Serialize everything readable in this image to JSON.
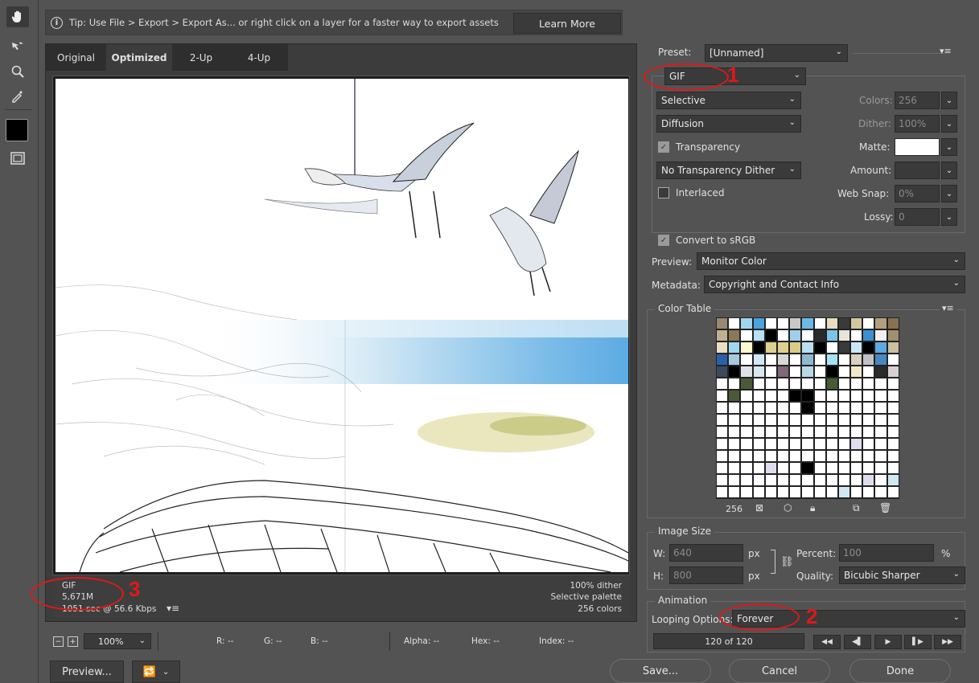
{
  "tip": {
    "text": "Tip: Use File > Export > Export As...  or right click on a layer for a faster way to export assets",
    "learn_more": "Learn More"
  },
  "tabs": [
    "Original",
    "Optimized",
    "2-Up",
    "4-Up"
  ],
  "image_info": {
    "format": "GIF",
    "size": "5,671M",
    "time": "1051 sec @ 56.6 Kbps",
    "dither": "100% dither",
    "palette": "Selective palette",
    "colors": "256 colors"
  },
  "status": {
    "zoom": "100%",
    "r": "R: --",
    "g": "G: --",
    "b": "B: --",
    "alpha": "Alpha: --",
    "hex": "Hex: --",
    "index": "Index: --"
  },
  "buttons": {
    "preview": "Preview...",
    "save": "Save...",
    "cancel": "Cancel",
    "done": "Done"
  },
  "settings": {
    "preset_label": "Preset:",
    "preset_value": "[Unnamed]",
    "format": "GIF",
    "reduction": "Selective",
    "dither_algo": "Diffusion",
    "colors_label": "Colors:",
    "colors_value": "256",
    "dither_label": "Dither:",
    "dither_value": "100%",
    "transparency_label": "Transparency",
    "matte_label": "Matte:",
    "transparency_dither": "No Transparency Dither",
    "amount_label": "Amount:",
    "interlaced_label": "Interlaced",
    "websnap_label": "Web Snap:",
    "websnap_value": "0%",
    "lossy_label": "Lossy:",
    "lossy_value": "0",
    "convert_srgb": "Convert to sRGB",
    "preview_label": "Preview:",
    "preview_value": "Monitor Color",
    "metadata_label": "Metadata:",
    "metadata_value": "Copyright and Contact Info"
  },
  "color_table": {
    "title": "Color Table",
    "count": "256"
  },
  "image_size": {
    "title": "Image Size",
    "w_label": "W:",
    "w_value": "640",
    "h_label": "H:",
    "h_value": "800",
    "unit": "px",
    "percent_label": "Percent:",
    "percent_value": "100",
    "percent_unit": "%",
    "quality_label": "Quality:",
    "quality_value": "Bicubic Sharper"
  },
  "animation": {
    "title": "Animation",
    "looping_label": "Looping Options:",
    "looping_value": "Forever",
    "frame": "120 of 120"
  },
  "annotations": [
    "1",
    "2",
    "3"
  ],
  "colors": {
    "accent_red": "#e01818"
  }
}
